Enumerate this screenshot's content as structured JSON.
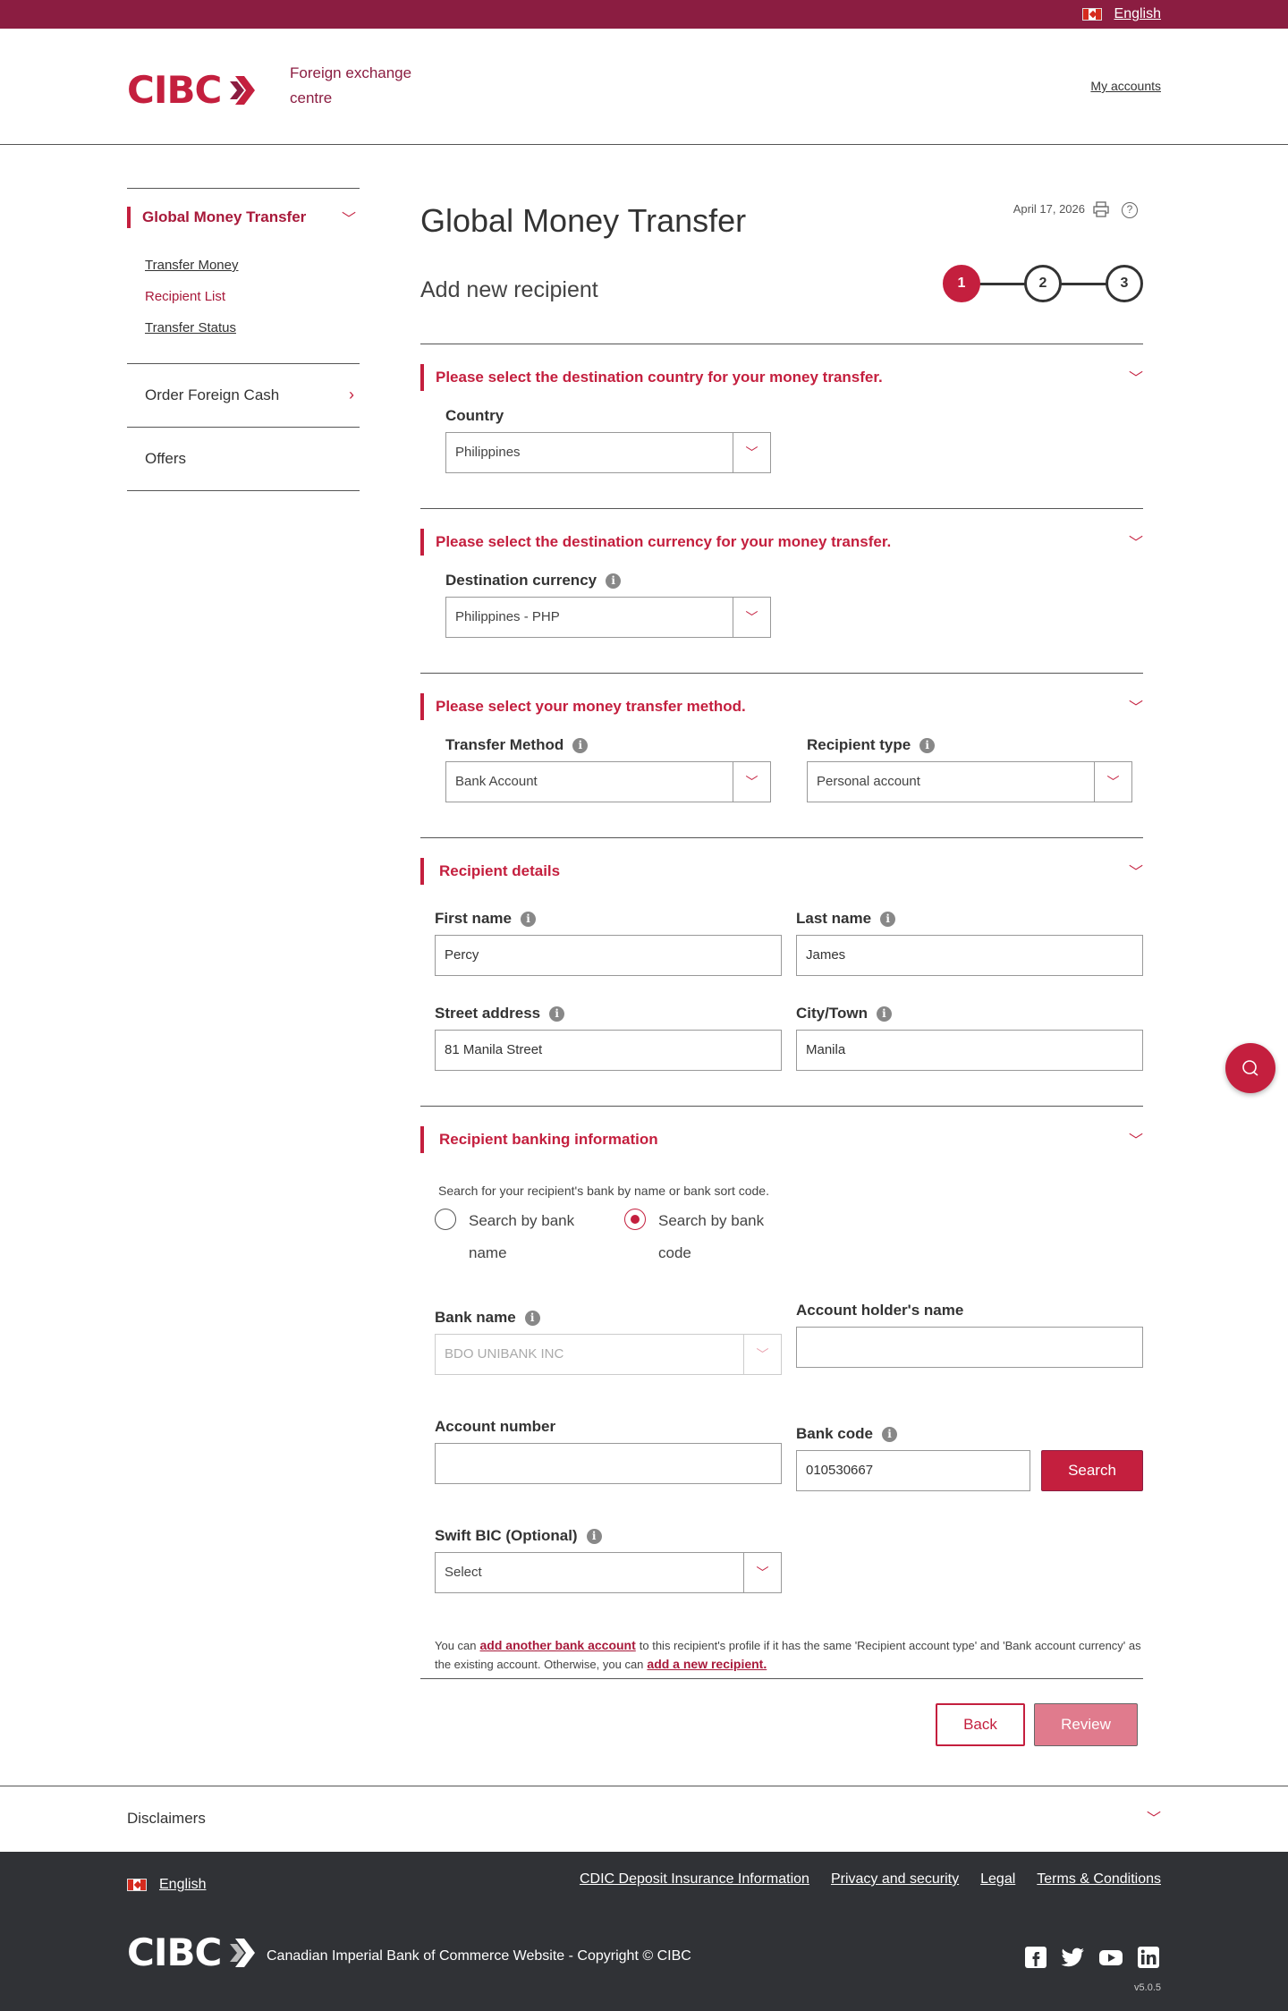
{
  "topbar": {
    "language": "English"
  },
  "header": {
    "brand": "CIBC",
    "tagline": "Foreign exchange centre",
    "my_accounts": "My accounts"
  },
  "sidebar": {
    "main": "Global Money Transfer",
    "sub": [
      "Transfer Money",
      "Recipient List",
      "Transfer Status"
    ],
    "items": [
      "Order Foreign Cash",
      "Offers"
    ]
  },
  "page": {
    "title": "Global Money Transfer",
    "date": "April 17, 2026",
    "subtitle": "Add new recipient",
    "steps": [
      "1",
      "2",
      "3"
    ],
    "current_step": 1
  },
  "destination_country": {
    "heading": "Please select the destination country for your money transfer.",
    "label": "Country",
    "value": "Philippines"
  },
  "destination_currency": {
    "heading": "Please select the destination currency for your money transfer.",
    "label": "Destination currency",
    "value": "Philippines - PHP"
  },
  "transfer_method": {
    "heading": "Please select your money transfer method.",
    "method_label": "Transfer Method",
    "method_value": "Bank Account",
    "type_label": "Recipient type",
    "type_value": "Personal account"
  },
  "recipient_details": {
    "heading": "Recipient details",
    "first_name_label": "First name",
    "first_name": "Percy",
    "last_name_label": "Last name",
    "last_name": "James",
    "street_label": "Street address",
    "street": "81 Manila Street",
    "city_label": "City/Town",
    "city": "Manila"
  },
  "banking": {
    "heading": "Recipient banking information",
    "help": "Search for your recipient's bank by name or bank sort code.",
    "radio_by_name": "Search by bank name",
    "radio_by_code": "Search by bank code",
    "bank_name_label": "Bank name",
    "bank_name": "BDO UNIBANK INC",
    "holder_label": "Account holder's name",
    "holder_value": "",
    "account_label": "Account number",
    "account_value": "",
    "code_label": "Bank code",
    "code_value": "010530667",
    "search": "Search",
    "swift_label": "Swift BIC (Optional)",
    "swift_value": "Select"
  },
  "footnote": {
    "part1": "You can",
    "link1": "add another bank account",
    "part2": "to this recipient's profile if it has the same 'Recipient account type' and 'Bank account currency' as the existing account. Otherwise, you can",
    "link2": "add a new recipient."
  },
  "actions": {
    "back": "Back",
    "review": "Review"
  },
  "disclaimers": "Disclaimers",
  "footer": {
    "language": "English",
    "links": [
      "CDIC Deposit Insurance Information",
      "Privacy and security",
      "Legal",
      "Terms & Conditions"
    ],
    "brand": "CIBC",
    "copyright": "Canadian Imperial Bank of Commerce Website - Copyright © CIBC",
    "version": "v5.0.5"
  },
  "colors": {
    "brand": "#c41f3e",
    "topbar": "#8b1d41",
    "footer": "#303236"
  }
}
